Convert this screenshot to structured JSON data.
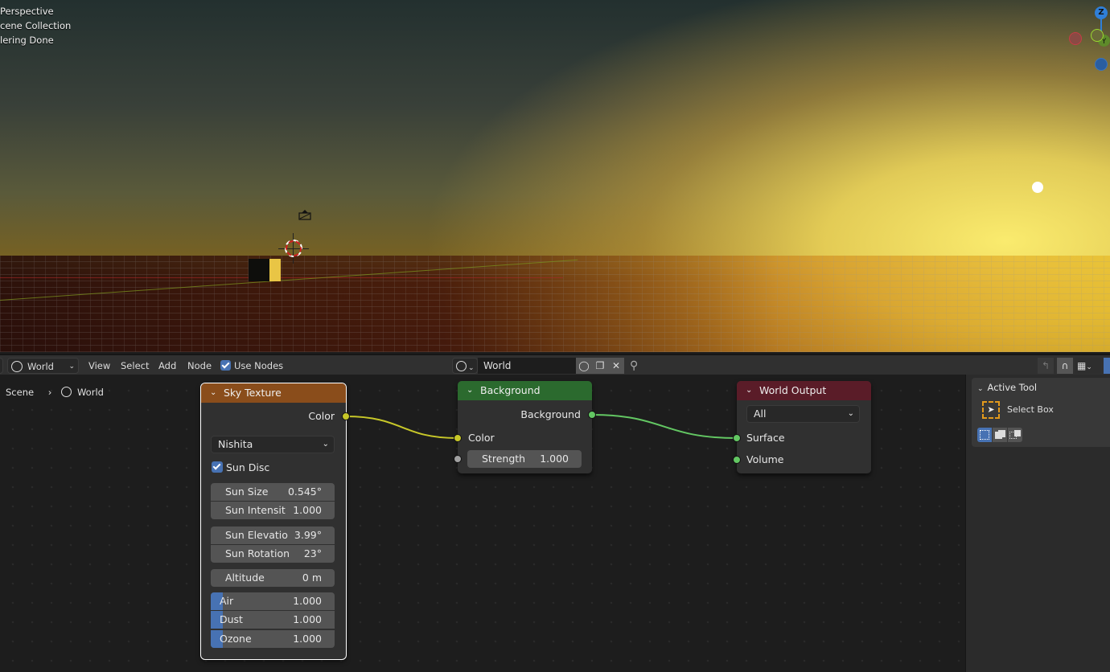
{
  "viewport": {
    "overlay_lines": [
      "Perspective",
      "cene Collection",
      "lering Done"
    ],
    "gizmo": {
      "z_label": "Z",
      "y_label": "Y",
      "colors": {
        "z": "#2f7fd8",
        "x": "#c63c46",
        "y": "#69a52f",
        "neg_z": "#2a5ea0"
      }
    },
    "icons": [
      "camera-icon",
      "3d-cursor-icon",
      "sun-lamp",
      "cube-object"
    ]
  },
  "node_header": {
    "editor_type_icon": "world-icon",
    "shader_type": "World",
    "menus": [
      "View",
      "Select",
      "Add",
      "Node"
    ],
    "use_nodes": {
      "label": "Use Nodes",
      "checked": true
    },
    "datablock": {
      "icon": "world-icon",
      "name": "World"
    },
    "datablock_buttons": [
      "fake-user-shield-icon",
      "duplicate-icon",
      "close-icon"
    ],
    "pin_icon": "pin-icon",
    "right_icons": [
      "parent-node-icon",
      "snap-icon",
      "snap-grid-icon",
      "overlay-icon"
    ]
  },
  "breadcrumb": [
    "Scene",
    "World"
  ],
  "nodes": {
    "sky_texture": {
      "title": "Sky Texture",
      "header_color": "#8a4d1b",
      "output": "Color",
      "sky_type": "Nishita",
      "sun_disc": {
        "label": "Sun Disc",
        "checked": true
      },
      "fields": [
        {
          "label": "Sun Size",
          "value": "0.545°"
        },
        {
          "label": "Sun Intensit",
          "value": "1.000"
        },
        {
          "label": "Sun Elevatio",
          "value": "3.99°"
        },
        {
          "label": "Sun Rotation",
          "value": "23°"
        },
        {
          "label": "Altitude",
          "value": "0 m"
        }
      ],
      "sliders": [
        {
          "label": "Air",
          "value": "1.000",
          "fraction": 0.1
        },
        {
          "label": "Dust",
          "value": "1.000",
          "fraction": 0.1
        },
        {
          "label": "Ozone",
          "value": "1.000",
          "fraction": 0.1
        }
      ]
    },
    "background": {
      "title": "Background",
      "header_color": "#2b6a2e",
      "output": "Background",
      "inputs": [
        "Color"
      ],
      "strength": {
        "label": "Strength",
        "value": "1.000"
      }
    },
    "world_output": {
      "title": "World Output",
      "header_color": "#5a1c28",
      "target": "All",
      "inputs": [
        "Surface",
        "Volume"
      ]
    }
  },
  "sidebar": {
    "panel_title": "Active Tool",
    "tool_name": "Select Box",
    "mode_buttons": [
      "select-new-icon",
      "select-extend-icon",
      "select-subtract-icon"
    ]
  }
}
